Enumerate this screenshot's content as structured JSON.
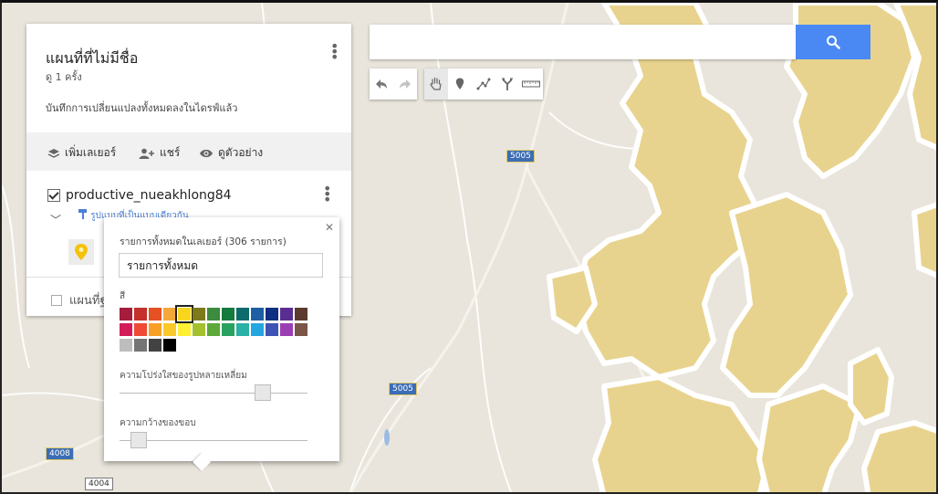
{
  "map": {
    "road_shields": [
      {
        "label": "5005",
        "style": "blue"
      },
      {
        "label": "5005",
        "style": "blue"
      },
      {
        "label": "4008",
        "style": "blue"
      },
      {
        "label": "4004",
        "style": "white"
      }
    ],
    "area_color": "#e8d38e",
    "area_edge_color": "#ffffff"
  },
  "panel": {
    "title": "แผนที่ที่ไม่มีชื่อ",
    "views": "ดู 1 ครั้ง",
    "saved_status": "บันทึกการเปลี่ยนแปลงทั้งหมดลงในไดรฟ์แล้ว",
    "actions": {
      "add_layer": "เพิ่มเลเยอร์",
      "share": "แชร์",
      "preview": "ดูตัวอย่าง"
    },
    "layer": {
      "name": "productive_nueakhlong84",
      "checked": true,
      "style_link": "รูปแบบที่เป็นแบบเดียวกัน"
    },
    "base_layer": {
      "label": "แผนที่ฐาน"
    }
  },
  "search": {
    "value": "",
    "placeholder": ""
  },
  "toolbar": {
    "tools": [
      "undo-icon",
      "redo-icon",
      "hand-icon",
      "marker-icon",
      "draw-line-icon",
      "directions-icon",
      "ruler-icon"
    ]
  },
  "popup": {
    "header": "รายการทั้งหมดในเลเยอร์  (306 รายการ)",
    "selected_group": "รายการทั้งหมด",
    "color_label": "สี",
    "selected_color": "#f9d61e",
    "colors_row1": [
      "#a51c3d",
      "#c4302b",
      "#e65123",
      "#f4a83c",
      "#f9d61e",
      "#7d7a1c",
      "#3d8b3d",
      "#157a3e",
      "#0e6b6b",
      "#1d5fa3",
      "#0f2f80",
      "#5a2e91",
      "#5b3a30"
    ],
    "colors_row2": [
      "#d41b5a",
      "#ef4a36",
      "#f7a025",
      "#f9c92a",
      "#fff033",
      "#a4c02c",
      "#5ca838",
      "#2aa25f",
      "#2ab1a5",
      "#24a6e0",
      "#3e54b4",
      "#9c3eb3",
      "#7a5548"
    ],
    "colors_row3": [
      "#bdbdbd",
      "#757575",
      "#424242",
      "#000000"
    ],
    "opacity_label": "ความโปร่งใสของรูปหลายเหลี่ยม",
    "opacity_value": 0.76,
    "border_label": "ความกว้างของขอบ",
    "border_value": 0.1
  }
}
